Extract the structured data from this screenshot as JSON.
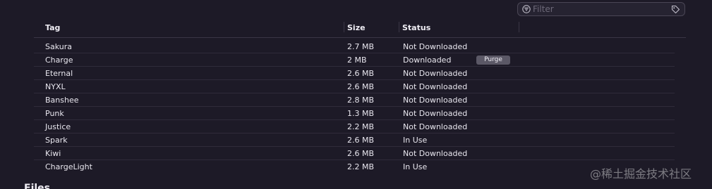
{
  "filter": {
    "placeholder": "Filter",
    "value": "",
    "left_icon": "filter-circle-icon",
    "right_icon": "tag-icon"
  },
  "table": {
    "columns": [
      "Tag",
      "Size",
      "Status"
    ],
    "rows": [
      {
        "tag": "Sakura",
        "size": "2.7 MB",
        "status": "Not Downloaded"
      },
      {
        "tag": "Charge",
        "size": "2 MB",
        "status": "Downloaded",
        "action": "Purge"
      },
      {
        "tag": "Eternal",
        "size": "2.6 MB",
        "status": "Not Downloaded"
      },
      {
        "tag": "NYXL",
        "size": "2.6 MB",
        "status": "Not Downloaded"
      },
      {
        "tag": "Banshee",
        "size": "2.8 MB",
        "status": "Not Downloaded"
      },
      {
        "tag": "Punk",
        "size": "1.3 MB",
        "status": "Not Downloaded"
      },
      {
        "tag": "Justice",
        "size": "2.2 MB",
        "status": "Not Downloaded"
      },
      {
        "tag": "Spark",
        "size": "2.6 MB",
        "status": "In Use"
      },
      {
        "tag": "Kiwi",
        "size": "2.6 MB",
        "status": "Not Downloaded"
      },
      {
        "tag": "ChargeLight",
        "size": "2.2 MB",
        "status": "In Use"
      }
    ]
  },
  "next_section": {
    "title": "Files"
  },
  "watermark": "@稀土掘金技术社区",
  "colors": {
    "background": "#1d1a27",
    "purge_button": "#5b5866",
    "divider": "#2f2b3a"
  }
}
